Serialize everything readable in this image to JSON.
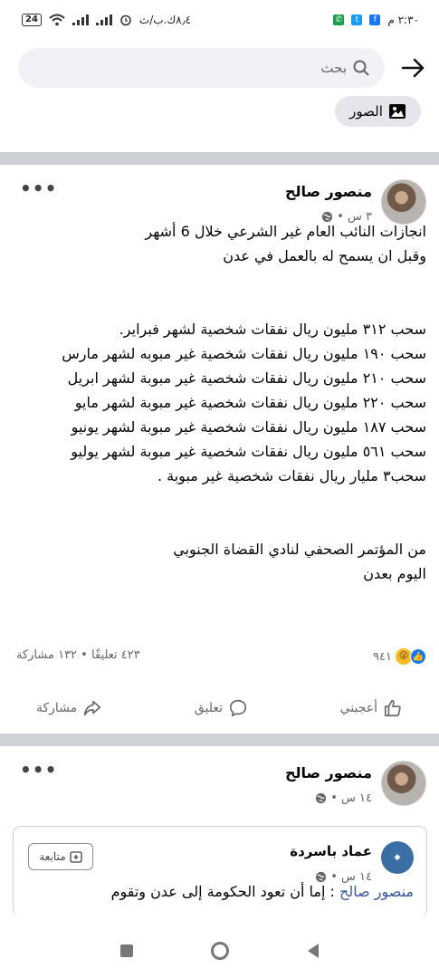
{
  "status_bar": {
    "time": "٢:٣٠ م",
    "left_text": "٨٫٤ك.ب/ث",
    "battery": "24"
  },
  "search": {
    "placeholder": "بحث"
  },
  "photos_chip": {
    "label": "الصور"
  },
  "posts": [
    {
      "author": "منصور صالح",
      "time": "٣ س •",
      "text": "انجازات النائب العام غير الشرعي  خلال 6 أشهر\nوقبل ان يسمح له بالعمل في عدن\n\n\nسحب ٣١٢ مليون ريال نفقات شخصية لشهر فبراير.\n سحب ١٩٠ مليون ريال نفقات شخصية غير مبوبه لشهر مارس\nسحب ٢١٠ مليون ريال نفقات شخصية غير مبوبة لشهر ابريل\nسحب ٢٢٠ مليون ريال نفقات شخصية غير مبوبة لشهر مايو\nسحب ١٨٧ مليون ريال نفقات  شخصية غير مبوبة لشهر  يونيو\nسحب ٥٦١ مليون ريال نفقات شخصية غير مبوبة لشهر يوليو\nسحب٣ مليار ريال نفقات  شخصية غير مبوبة  .\n\n\nمن المؤتمر الصحفي لنادي القضاة الجنوبي\nاليوم بعدن",
      "reaction_count": "٩٤١",
      "counts_text": "٤٢٣ تعليقًا • ١٣٢ مشاركة"
    },
    {
      "author": "منصور صالح",
      "time": "١٤ س •"
    }
  ],
  "actions": {
    "like": "أعجبني",
    "comment": "تعليق",
    "share": "مشاركة"
  },
  "shared_post": {
    "author": "عماد باسردة",
    "time": "١٤ س •",
    "follow_label": "متابعة",
    "mention": "منصور صالح",
    "text": " : إما أن تعود الحكومة إلى عدن وتقوم"
  },
  "colors": {
    "like_blue": "#1877f2",
    "wow_yellow": "#f7b928",
    "divider": "#cdd0d5"
  }
}
